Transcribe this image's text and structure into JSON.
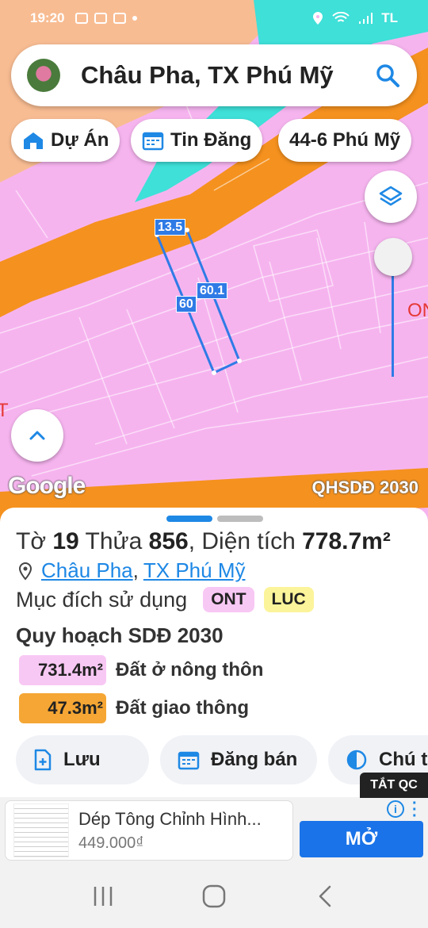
{
  "status_bar": {
    "time": "19:20",
    "carrier": "TL"
  },
  "search": {
    "query": "Châu Pha, TX Phú Mỹ"
  },
  "chips": [
    {
      "label": "Dự Án",
      "icon": "house-icon"
    },
    {
      "label": "Tin Đăng",
      "icon": "calendar-icon"
    },
    {
      "label": "44-6 Phú Mỹ",
      "icon": ""
    }
  ],
  "map": {
    "dimension_labels": [
      "13.5",
      "60.1",
      "60"
    ],
    "land_code_right": "ON",
    "land_code_left": "T",
    "logo": "Google",
    "plan_layer": "QHSDĐ 2030",
    "colors": {
      "residential": "#f6b4ef",
      "road": "#f5911e",
      "water": "#3ee0d8",
      "farmland": "#f8bc92"
    }
  },
  "parcel": {
    "sheet_prefix": "Tờ",
    "sheet_no": "19",
    "plot_prefix": "Thửa",
    "plot_no": "856",
    "area_prefix": ", Diện tích",
    "area": "778.7m²",
    "commune": "Châu Pha",
    "town": "TX Phú Mỹ",
    "usage_label": "Mục đích sử dụng",
    "usage_codes": [
      {
        "code": "ONT",
        "color": "#f8c8f4"
      },
      {
        "code": "LUC",
        "color": "#fbf49a"
      }
    ],
    "plan_title": "Quy hoạch SDĐ 2030",
    "plan_items": [
      {
        "area": "731.4m²",
        "label": "Đất ở nông thôn",
        "color": "#f8c8f4"
      },
      {
        "area": "47.3m²",
        "label": "Đất giao thông",
        "color": "#f5a634"
      }
    ]
  },
  "actions": [
    {
      "label": "Lưu",
      "icon": "save-file-icon"
    },
    {
      "label": "Đăng bán",
      "icon": "calendar-icon"
    },
    {
      "label": "Chú t",
      "icon": "contrast-icon"
    }
  ],
  "ad": {
    "close_label": "TẮT QC",
    "title": "Dép Tông Chỉnh Hình...",
    "price": "449.000₫",
    "info": "i",
    "cta": "MỞ"
  }
}
